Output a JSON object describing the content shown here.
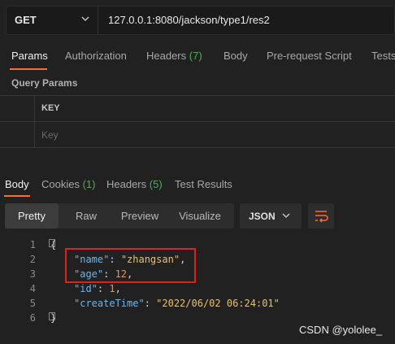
{
  "request": {
    "method": "GET",
    "url": "127.0.0.1:8080/jackson/type1/res2"
  },
  "request_tabs": [
    {
      "label": "Params",
      "count": "",
      "active": true
    },
    {
      "label": "Authorization",
      "count": ""
    },
    {
      "label": "Headers",
      "count": "(7)"
    },
    {
      "label": "Body",
      "count": ""
    },
    {
      "label": "Pre-request Script",
      "count": ""
    },
    {
      "label": "Tests",
      "count": ""
    }
  ],
  "query_params": {
    "title": "Query Params",
    "key_header": "KEY",
    "key_placeholder": "Key"
  },
  "response_tabs": [
    {
      "label": "Body",
      "count": "",
      "active": true
    },
    {
      "label": "Cookies",
      "count": "(1)"
    },
    {
      "label": "Headers",
      "count": "(5)"
    },
    {
      "label": "Test Results",
      "count": ""
    }
  ],
  "format_buttons": [
    "Pretty",
    "Raw",
    "Preview",
    "Visualize"
  ],
  "format_selected": "JSON",
  "code": {
    "line_numbers": [
      "1",
      "2",
      "3",
      "4",
      "5",
      "6"
    ],
    "open_brace": "{",
    "close_brace": "}",
    "fields": [
      {
        "key": "\"name\"",
        "value": "\"zhangsan\"",
        "trail": ","
      },
      {
        "key": "\"age\"",
        "value": "12",
        "trail": ","
      },
      {
        "key": "\"id\"",
        "value": "1",
        "trail": ","
      },
      {
        "key": "\"createTime\"",
        "value": "\"2022/06/02 06:24:01\"",
        "trail": ""
      }
    ]
  },
  "watermark": "CSDN @yololee_",
  "colors": {
    "accent": "#ff6c37",
    "count": "#4caf50",
    "highlight": "#e01f1f"
  }
}
